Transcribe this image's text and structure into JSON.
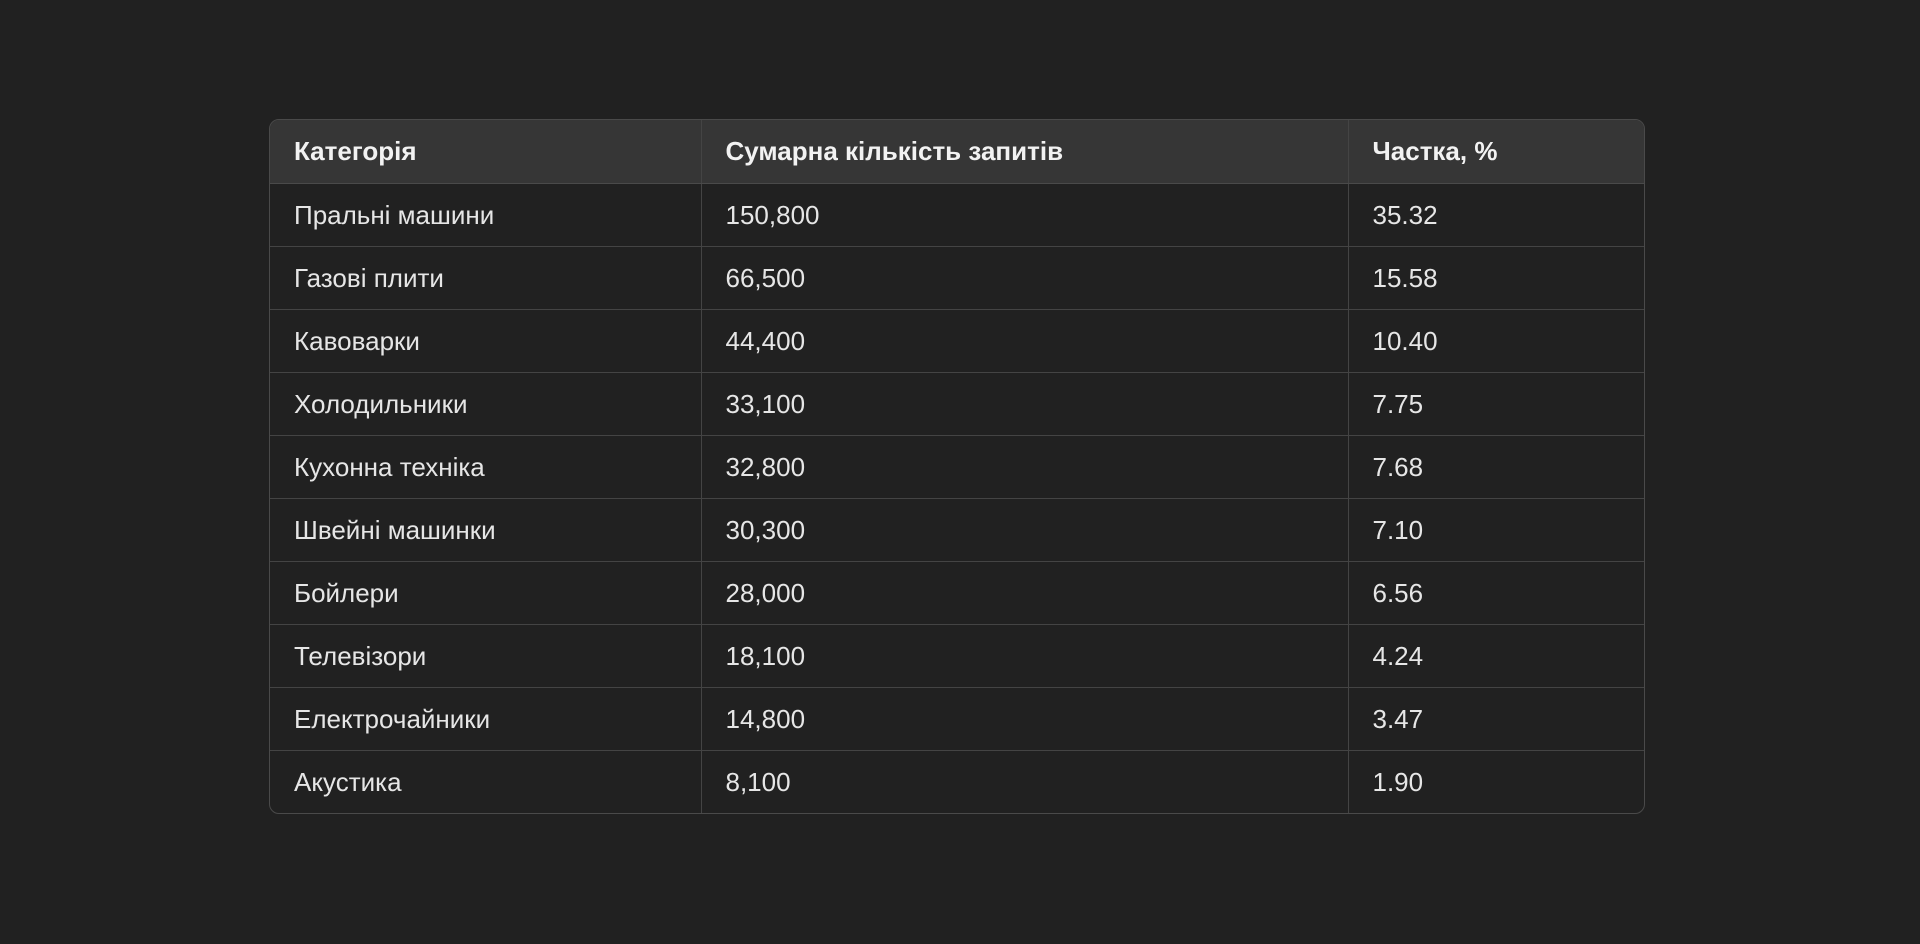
{
  "table": {
    "headers": [
      "Категорія",
      "Сумарна кількість запитів",
      "Частка, %"
    ],
    "rows": [
      [
        "Пральні машини",
        "150,800",
        "35.32"
      ],
      [
        "Газові плити",
        "66,500",
        "15.58"
      ],
      [
        "Кавоварки",
        "44,400",
        "10.40"
      ],
      [
        "Холодильники",
        "33,100",
        "7.75"
      ],
      [
        "Кухонна техніка",
        "32,800",
        "7.68"
      ],
      [
        "Швейні машинки",
        "30,300",
        "7.10"
      ],
      [
        "Бойлери",
        "28,000",
        "6.56"
      ],
      [
        "Телевізори",
        "18,100",
        "4.24"
      ],
      [
        "Електрочайники",
        "14,800",
        "3.47"
      ],
      [
        "Акустика",
        "8,100",
        "1.90"
      ]
    ]
  },
  "colors": {
    "background": "#212121",
    "header_background": "#363636",
    "border": "#444444",
    "text": "#ececec"
  }
}
